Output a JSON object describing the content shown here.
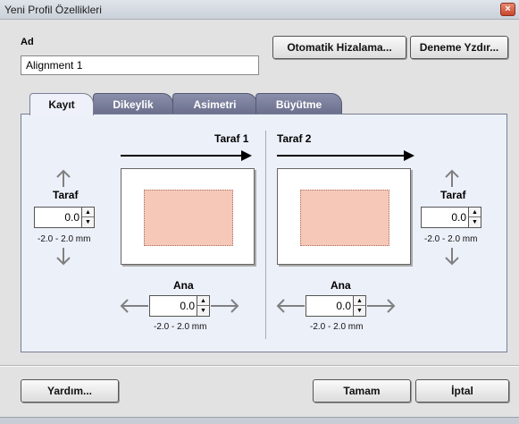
{
  "window": {
    "title": "Yeni Profil Özellikleri",
    "close_glyph": "×"
  },
  "name_field": {
    "label": "Ad",
    "value": "Alignment 1"
  },
  "buttons": {
    "auto_align": "Otomatik Hizalama...",
    "test_print": "Deneme Yzdır...",
    "help": "Yardım...",
    "ok": "Tamam",
    "cancel": "İptal"
  },
  "tabs": [
    {
      "label": "Kayıt",
      "active": true
    },
    {
      "label": "Dikeylik",
      "active": false
    },
    {
      "label": "Asimetri",
      "active": false
    },
    {
      "label": "Büyütme",
      "active": false
    }
  ],
  "side1": {
    "title": "Taraf 1",
    "vertical": {
      "label": "Taraf",
      "value": "0.0",
      "range": "-2.0 - 2.0 mm"
    },
    "horizontal": {
      "label": "Ana",
      "value": "0.0",
      "range": "-2.0 - 2.0 mm"
    }
  },
  "side2": {
    "title": "Taraf 2",
    "vertical": {
      "label": "Taraf",
      "value": "0.0",
      "range": "-2.0 - 2.0 mm"
    },
    "horizontal": {
      "label": "Ana",
      "value": "0.0",
      "range": "-2.0 - 2.0 mm"
    }
  },
  "icons": {
    "up_arrow": "up-arrow-icon",
    "down_arrow": "down-arrow-icon",
    "left_arrow": "left-arrow-icon",
    "right_arrow": "right-arrow-icon",
    "spin_up": "▲",
    "spin_down": "▼"
  },
  "colors": {
    "tab_inactive": "#6a6e8c",
    "panel": "#ecf0f9",
    "image_area": "#f5c8b8",
    "close_button": "#c8452c"
  }
}
